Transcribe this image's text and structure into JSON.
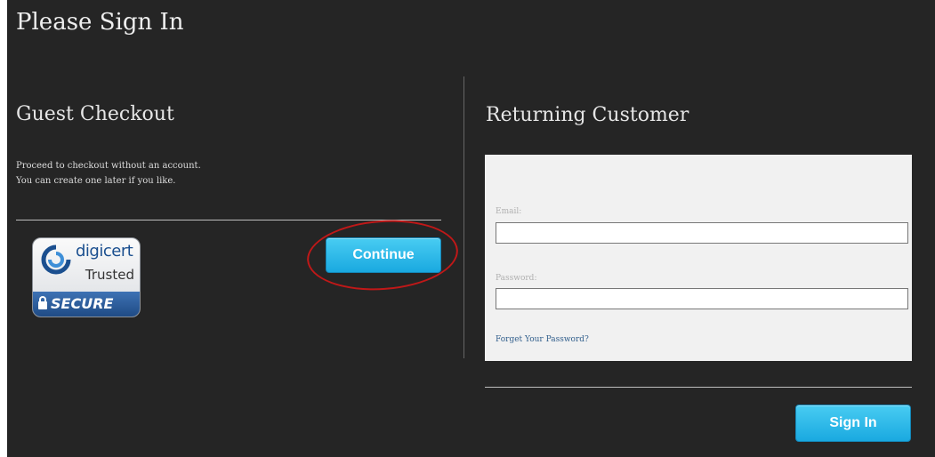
{
  "page": {
    "title": "Please Sign In"
  },
  "guest": {
    "title": "Guest Checkout",
    "description_line1": "Proceed to checkout without an account.",
    "description_line2": "You can create one later if you like.",
    "continue_label": "Continue",
    "badge": {
      "brand": "digicert",
      "trusted": "Trusted",
      "secure": "SECURE"
    }
  },
  "returning": {
    "title": "Returning Customer",
    "email_label": "Email:",
    "email_value": "",
    "password_label": "Password:",
    "password_value": "",
    "forgot_link": "Forget Your Password?",
    "signin_label": "Sign In"
  },
  "colors": {
    "panel_bg": "#252525",
    "button": "#29b6ea",
    "annotation": "#c01818"
  },
  "icons": [
    "digicert-logo-icon",
    "lock-icon"
  ]
}
